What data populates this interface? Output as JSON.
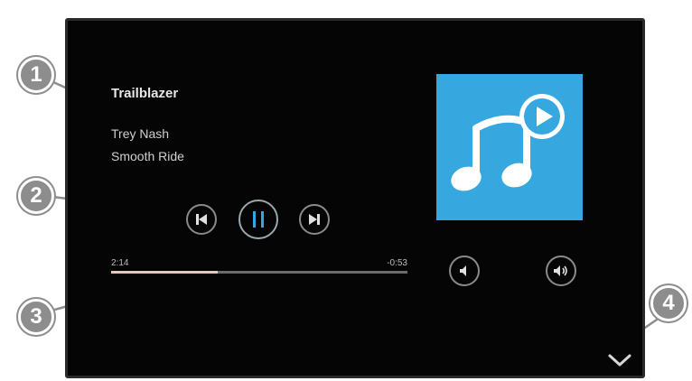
{
  "now_playing": {
    "title": "Trailblazer",
    "artist": "Trey Nash",
    "album": "Smooth Ride"
  },
  "playback": {
    "elapsed": "2:14",
    "remaining": "-0:53",
    "progress_fraction": 0.36
  },
  "controls": {
    "previous_icon": "skip-previous-icon",
    "pause_icon": "pause-icon",
    "next_icon": "skip-next-icon",
    "volume_down_icon": "volume-down-icon",
    "volume_up_icon": "volume-up-icon",
    "collapse_icon": "chevron-down-icon"
  },
  "album_art": {
    "icon": "music-notes-play-icon",
    "background_color": "#37a8df"
  },
  "callouts": {
    "c1": "1",
    "c2": "2",
    "c3": "3",
    "c4": "4"
  },
  "colors": {
    "screen_background": "#050505",
    "progress_fill": "#e8c7bd",
    "callout_fill": "#8d8d8d"
  }
}
